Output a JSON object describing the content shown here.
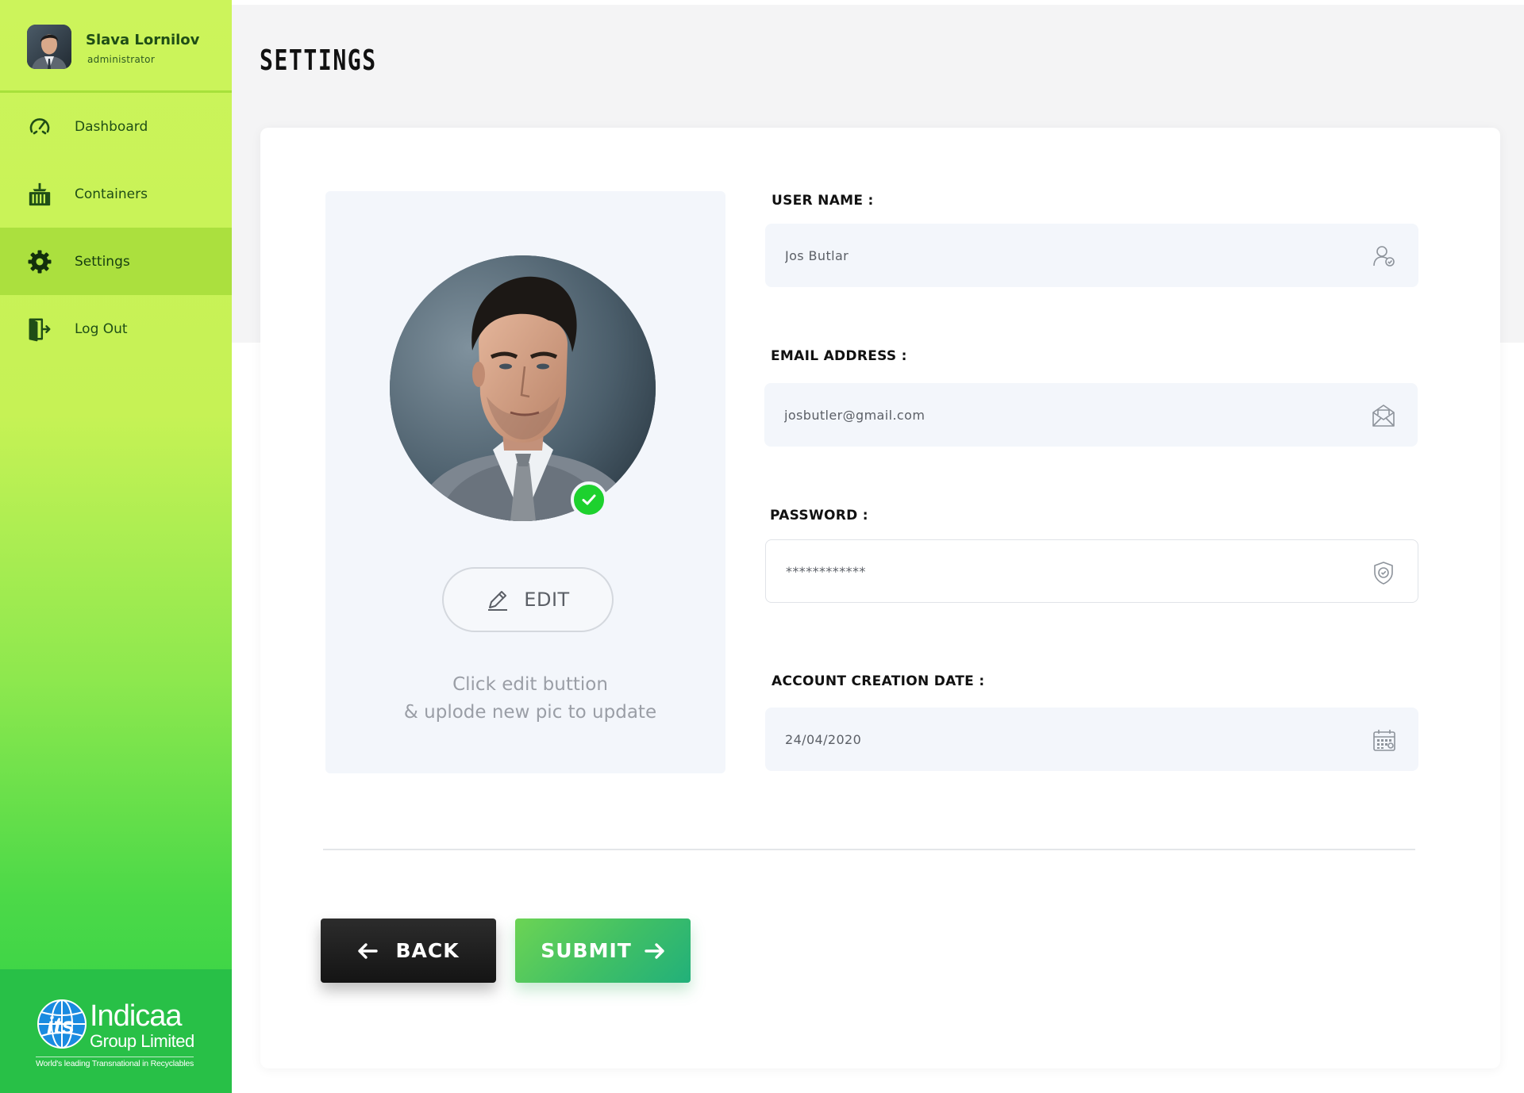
{
  "user": {
    "name": "Slava Lornilov",
    "role": "administrator"
  },
  "nav": {
    "items": [
      {
        "label": "Dashboard",
        "icon": "speedometer-icon"
      },
      {
        "label": "Containers",
        "icon": "container-icon"
      },
      {
        "label": "Settings",
        "icon": "gear-icon",
        "active": true
      },
      {
        "label": "Log Out",
        "icon": "logout-icon"
      }
    ]
  },
  "brand": {
    "name": "Indicaa",
    "subtitle": "Group Limited",
    "tagline": "World's leading Transnational in Recyclables"
  },
  "page": {
    "title": "SETTINGS"
  },
  "profile_photo": {
    "edit_label": "EDIT",
    "hint_line1": "Click edit buttion",
    "hint_line2": "& uplode new pic to update"
  },
  "form": {
    "username": {
      "label": "USER NAME :",
      "value": "Jos Butlar",
      "icon": "user-check-icon"
    },
    "email": {
      "label": "EMAIL ADDRESS :",
      "value": "josbutler@gmail.com",
      "icon": "envelope-icon"
    },
    "password": {
      "label": "PASSWORD :",
      "value": "************",
      "icon": "shield-check-icon"
    },
    "created": {
      "label": "ACCOUNT CREATION DATE :",
      "value": "24/04/2020",
      "icon": "calendar-icon"
    }
  },
  "actions": {
    "back_label": "BACK",
    "submit_label": "SUBMIT"
  },
  "colors": {
    "sidebar_top": "#ccf45b",
    "sidebar_bottom": "#2ccf45",
    "nav_active": "#abe03e",
    "nav_text": "#1f4e16",
    "verified": "#1dd12e",
    "submit_start": "#6cd454",
    "submit_end": "#22b07a",
    "back": "#1f1f1f"
  }
}
